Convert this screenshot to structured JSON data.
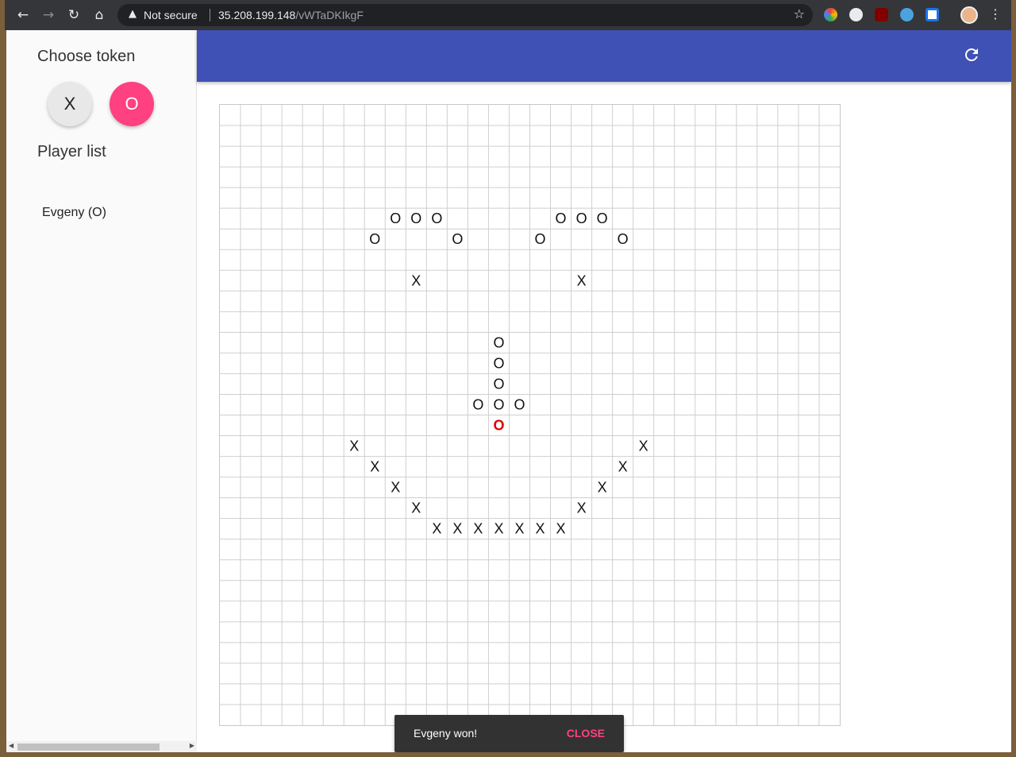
{
  "browser": {
    "security_label": "Not secure",
    "url_host": "35.208.199.148",
    "url_path": "/vWTaDKIkgF"
  },
  "sidebar": {
    "choose_token_title": "Choose token",
    "tokens": [
      {
        "label": "X",
        "selected": false
      },
      {
        "label": "O",
        "selected": true,
        "color": "#ff4081"
      }
    ],
    "player_list_title": "Player list",
    "players": [
      "Evgeny (O)"
    ]
  },
  "appbar": {
    "color": "#3f51b5",
    "refresh_icon": "refresh-icon"
  },
  "board": {
    "size": 30,
    "marks": [
      {
        "row": 5,
        "col": 8,
        "t": "O"
      },
      {
        "row": 5,
        "col": 9,
        "t": "O"
      },
      {
        "row": 5,
        "col": 10,
        "t": "O"
      },
      {
        "row": 5,
        "col": 16,
        "t": "O"
      },
      {
        "row": 5,
        "col": 17,
        "t": "O"
      },
      {
        "row": 5,
        "col": 18,
        "t": "O"
      },
      {
        "row": 6,
        "col": 7,
        "t": "O"
      },
      {
        "row": 6,
        "col": 11,
        "t": "O"
      },
      {
        "row": 6,
        "col": 15,
        "t": "O"
      },
      {
        "row": 6,
        "col": 19,
        "t": "O"
      },
      {
        "row": 8,
        "col": 9,
        "t": "X"
      },
      {
        "row": 8,
        "col": 17,
        "t": "X"
      },
      {
        "row": 11,
        "col": 13,
        "t": "O"
      },
      {
        "row": 12,
        "col": 13,
        "t": "O"
      },
      {
        "row": 13,
        "col": 13,
        "t": "O"
      },
      {
        "row": 14,
        "col": 12,
        "t": "O"
      },
      {
        "row": 14,
        "col": 13,
        "t": "O"
      },
      {
        "row": 14,
        "col": 14,
        "t": "O"
      },
      {
        "row": 15,
        "col": 13,
        "t": "O",
        "last": true
      },
      {
        "row": 16,
        "col": 6,
        "t": "X"
      },
      {
        "row": 16,
        "col": 20,
        "t": "X"
      },
      {
        "row": 17,
        "col": 7,
        "t": "X"
      },
      {
        "row": 17,
        "col": 19,
        "t": "X"
      },
      {
        "row": 18,
        "col": 8,
        "t": "X"
      },
      {
        "row": 18,
        "col": 18,
        "t": "X"
      },
      {
        "row": 19,
        "col": 9,
        "t": "X"
      },
      {
        "row": 19,
        "col": 17,
        "t": "X"
      },
      {
        "row": 20,
        "col": 10,
        "t": "X"
      },
      {
        "row": 20,
        "col": 11,
        "t": "X"
      },
      {
        "row": 20,
        "col": 12,
        "t": "X"
      },
      {
        "row": 20,
        "col": 13,
        "t": "X"
      },
      {
        "row": 20,
        "col": 14,
        "t": "X"
      },
      {
        "row": 20,
        "col": 15,
        "t": "X"
      },
      {
        "row": 20,
        "col": 16,
        "t": "X"
      }
    ],
    "last_move_color": "#e00000"
  },
  "snackbar": {
    "message": "Evgeny won!",
    "action": "CLOSE",
    "action_color": "#ff4081"
  }
}
